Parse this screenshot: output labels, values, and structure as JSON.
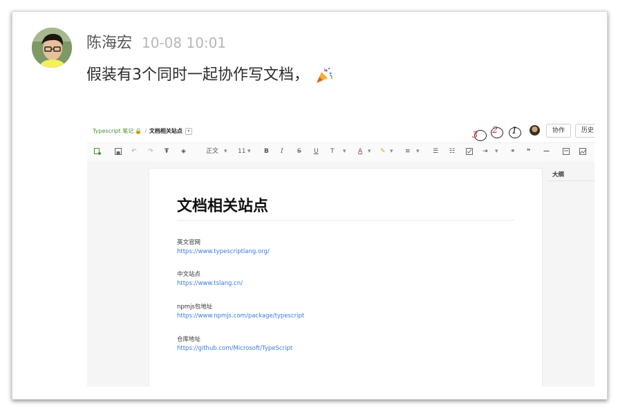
{
  "post": {
    "author": "陈海宏",
    "time": "10-08 10:01",
    "message": "假装有3个同时一起协作写文档，",
    "emoji": "party-popper"
  },
  "editor": {
    "breadcrumb": {
      "app": "Typescript 笔记",
      "separator": "/",
      "doc": "文档相关站点"
    },
    "annotations": [
      "3",
      "2",
      "1"
    ],
    "buttons": {
      "collab": "协作",
      "history": "历史"
    },
    "toolbar": {
      "paragraph_style": "正文",
      "font_size": "11",
      "bold": "B",
      "italic": "I",
      "strike": "S",
      "underline": "U",
      "superscript": "T",
      "font_color": "A",
      "quote": "❝",
      "divider": "—"
    },
    "outline_title": "大纲",
    "document": {
      "title": "文档相关站点",
      "sections": [
        {
          "label": "英文官网",
          "link": "https://www.typescriptlang.org/"
        },
        {
          "label": "中文站点",
          "link": "https://www.tslang.cn/"
        },
        {
          "label": "npmjs包地址",
          "link": "https://www.npmjs.com/package/typescript"
        },
        {
          "label": "仓库地址",
          "link": "https://github.com/Microsoft/TypeScript"
        }
      ]
    }
  },
  "colors": {
    "link": "#3d7bd6",
    "brand": "#4a8f2f",
    "time": "#b7b7b7"
  }
}
